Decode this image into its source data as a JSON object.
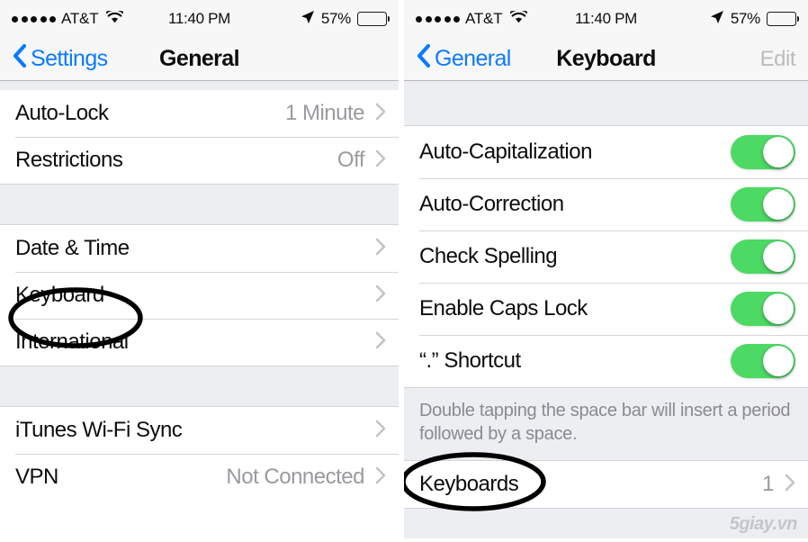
{
  "status_bar": {
    "carrier": "AT&T",
    "signal_dots": 5,
    "wifi_icon": "wifi-icon",
    "time": "11:40 PM",
    "location_icon": "location-arrow-icon",
    "battery_percent": "57%",
    "battery_level": 57
  },
  "left_screen": {
    "nav": {
      "back_label": "Settings",
      "back_icon": "chevron-left-icon",
      "title": "General"
    },
    "sections": [
      {
        "rows": [
          {
            "label": "Auto-Lock",
            "value": "1 Minute",
            "chevron": "chevron-right-icon"
          },
          {
            "label": "Restrictions",
            "value": "Off",
            "chevron": "chevron-right-icon"
          }
        ]
      },
      {
        "rows": [
          {
            "label": "Date & Time",
            "value": "",
            "chevron": "chevron-right-icon"
          },
          {
            "label": "Keyboard",
            "value": "",
            "chevron": "chevron-right-icon",
            "annotated": true
          },
          {
            "label": "International",
            "value": "",
            "chevron": "chevron-right-icon"
          }
        ]
      },
      {
        "rows": [
          {
            "label": "iTunes Wi-Fi Sync",
            "value": "",
            "chevron": "chevron-right-icon"
          },
          {
            "label": "VPN",
            "value": "Not Connected",
            "chevron": "chevron-right-icon"
          }
        ]
      }
    ]
  },
  "right_screen": {
    "nav": {
      "back_label": "General",
      "back_icon": "chevron-left-icon",
      "title": "Keyboard",
      "edit_label": "Edit"
    },
    "toggles": [
      {
        "label": "Auto-Capitalization",
        "state": "on"
      },
      {
        "label": "Auto-Correction",
        "state": "on"
      },
      {
        "label": "Check Spelling",
        "state": "on"
      },
      {
        "label": "Enable Caps Lock",
        "state": "on"
      },
      {
        "label": "“.” Shortcut",
        "state": "on"
      }
    ],
    "footer_note": "Double tapping the space bar will insert a period followed by a space.",
    "keyboards_row": {
      "label": "Keyboards",
      "value": "1",
      "chevron": "chevron-right-icon",
      "annotated": true
    }
  },
  "watermark": "5giay.vn",
  "colors": {
    "accent_blue": "#0a7bff",
    "toggle_green": "#4CD964",
    "disabled_gray": "#bcbcc0",
    "value_gray": "#9a9a9f",
    "section_bg": "#eceef2",
    "annotation": "#000000"
  }
}
